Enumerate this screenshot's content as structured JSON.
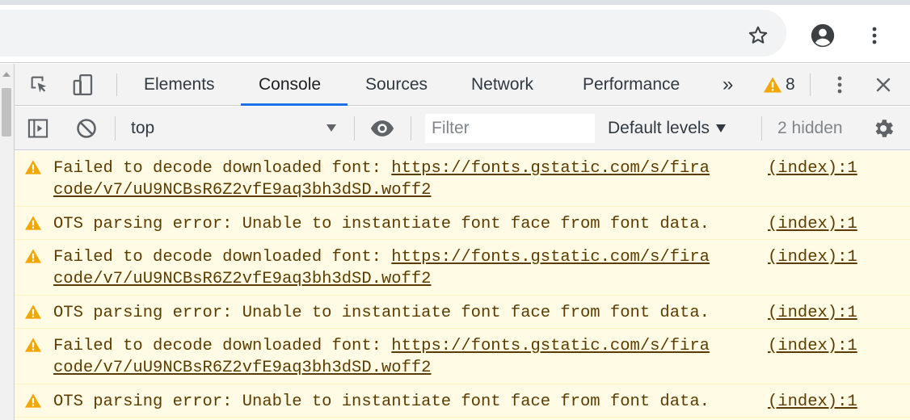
{
  "browser": {
    "bookmark_icon": "star-icon",
    "profile_icon": "account-circle-icon",
    "menu_icon": "more-vert-icon"
  },
  "devtools": {
    "tabs": [
      {
        "label": "Elements"
      },
      {
        "label": "Console"
      },
      {
        "label": "Sources"
      },
      {
        "label": "Network"
      },
      {
        "label": "Performance"
      }
    ],
    "more_tabs": "»",
    "warning_count": "8",
    "close_icon": "close-icon"
  },
  "filter": {
    "context": "top",
    "placeholder": "Filter",
    "levels": "Default levels",
    "hidden": "2 hidden"
  },
  "messages": [
    {
      "line1": "Failed to decode downloaded font: ",
      "link1": "https://fonts.gstatic.com/s/fira",
      "line2": "code/v7/uU9NCBsR6Z2vfE9aq3bh3dSD.woff2",
      "source": "(index):1"
    },
    {
      "line1": "OTS parsing error: Unable to instantiate font face from font data.",
      "source": "(index):1"
    },
    {
      "line1": "Failed to decode downloaded font: ",
      "link1": "https://fonts.gstatic.com/s/fira",
      "line2": "code/v7/uU9NCBsR6Z2vfE9aq3bh3dSD.woff2",
      "source": "(index):1"
    },
    {
      "line1": "OTS parsing error: Unable to instantiate font face from font data.",
      "source": "(index):1"
    },
    {
      "line1": "Failed to decode downloaded font: ",
      "link1": "https://fonts.gstatic.com/s/fira",
      "line2": "code/v7/uU9NCBsR6Z2vfE9aq3bh3dSD.woff2",
      "source": "(index):1"
    },
    {
      "line1": "OTS parsing error: Unable to instantiate font face from font data.",
      "source": "(index):1"
    }
  ],
  "colors": {
    "accent": "#1a73e8",
    "warning_icon": "#f2a600",
    "warning_bg": "#fffbe5",
    "warning_text": "#5c3c00"
  }
}
